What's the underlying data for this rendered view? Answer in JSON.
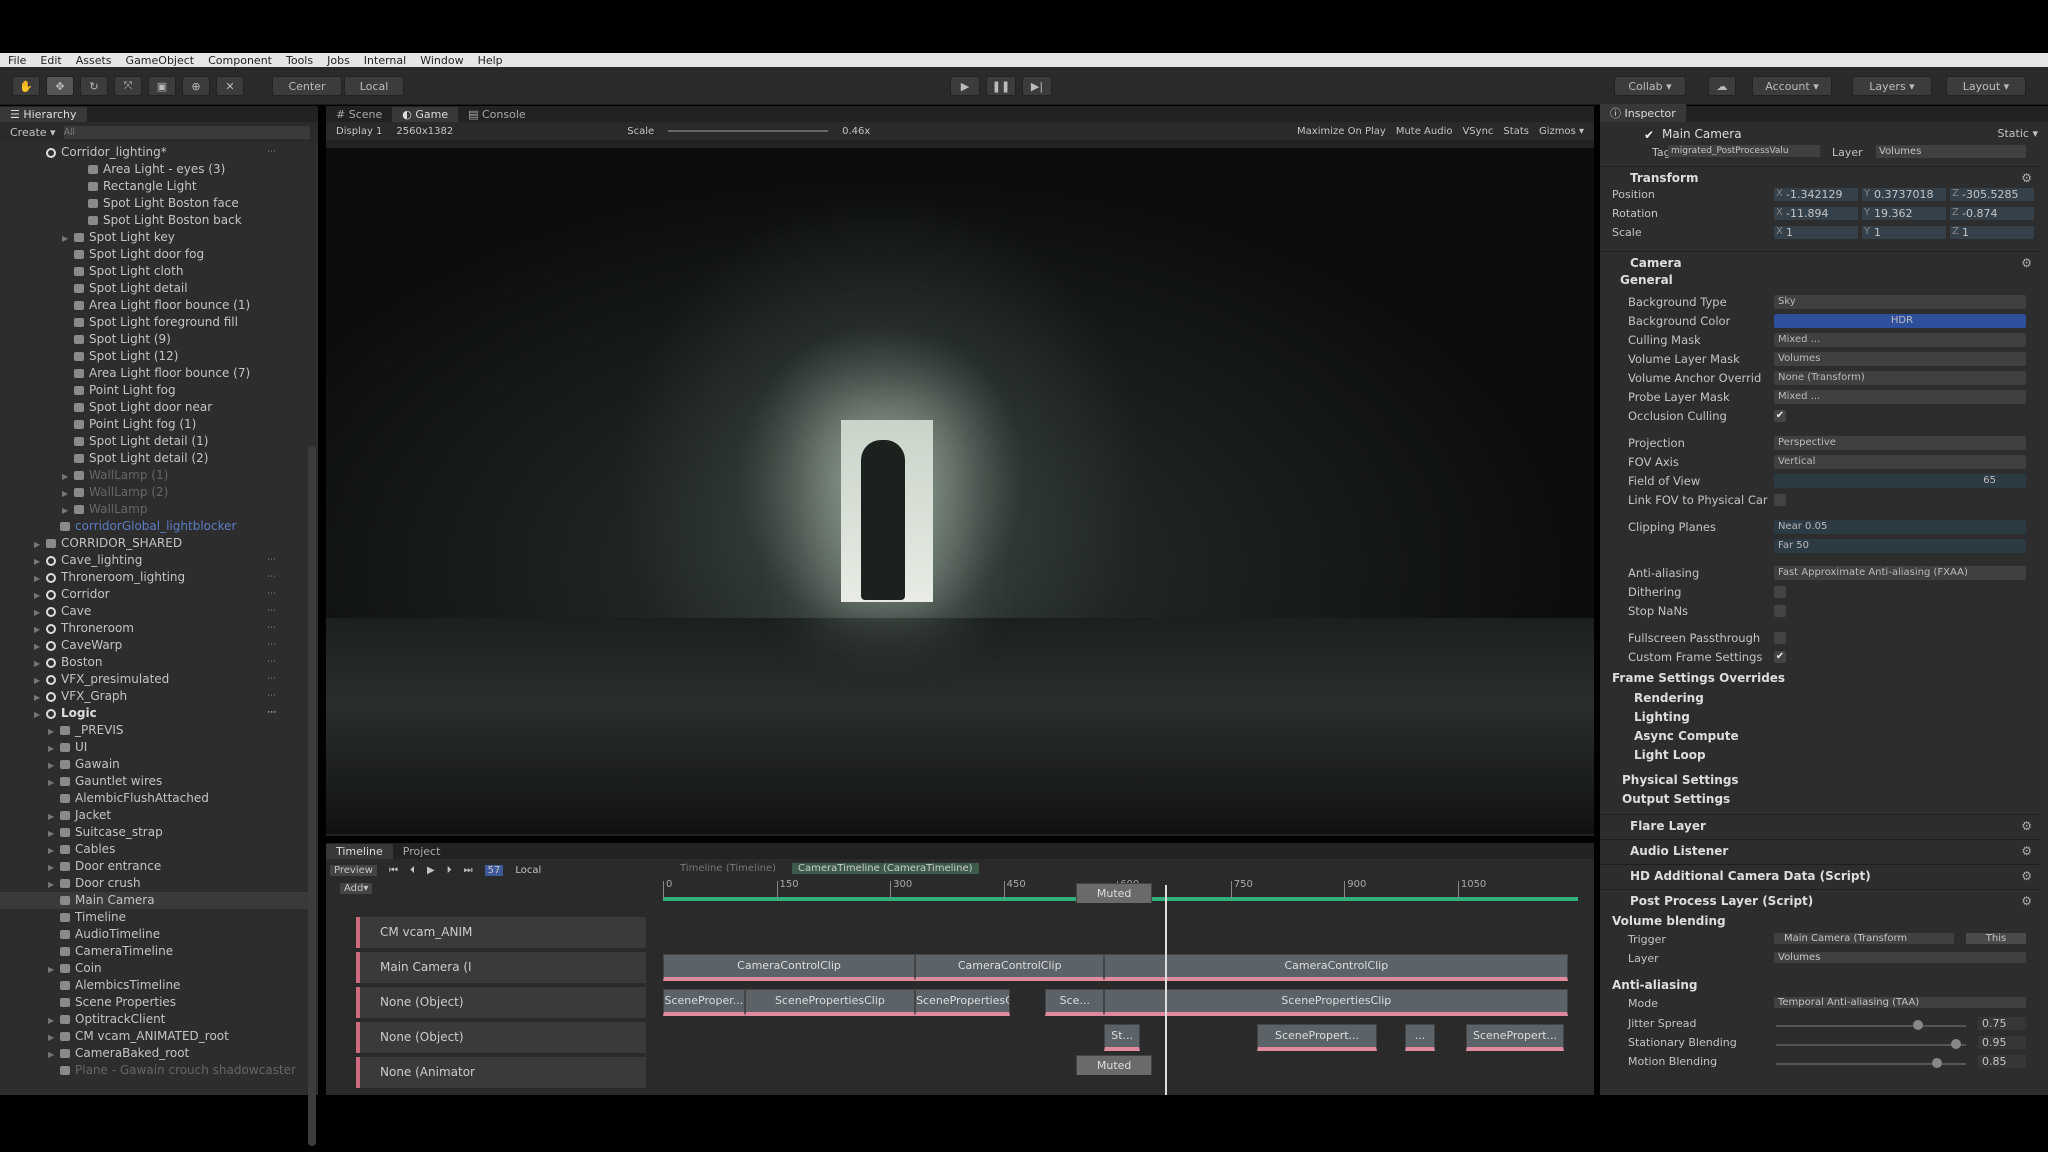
{
  "menu": [
    "File",
    "Edit",
    "Assets",
    "GameObject",
    "Component",
    "Tools",
    "Jobs",
    "Internal",
    "Window",
    "Help"
  ],
  "toolbar": {
    "center": "Center",
    "local": "Local",
    "collab": "Collab ▾",
    "account": "Account ▾",
    "layers": "Layers ▾",
    "layout": "Layout ▾"
  },
  "hierarchy": {
    "title": "Hierarchy",
    "create": "Create ▾",
    "search_placeholder": "All",
    "items": [
      {
        "label": "Corridor_lighting*",
        "depth": 1,
        "kind": "scene"
      },
      {
        "label": "Area Light - eyes (3)",
        "depth": 4,
        "kind": "obj"
      },
      {
        "label": "Rectangle Light",
        "depth": 4,
        "kind": "obj"
      },
      {
        "label": "Spot Light Boston face",
        "depth": 4,
        "kind": "obj"
      },
      {
        "label": "Spot Light Boston back",
        "depth": 4,
        "kind": "obj"
      },
      {
        "label": "Spot Light key",
        "depth": 3,
        "kind": "obj",
        "arrow": true
      },
      {
        "label": "Spot Light door fog",
        "depth": 3,
        "kind": "obj"
      },
      {
        "label": "Spot Light cloth",
        "depth": 3,
        "kind": "obj"
      },
      {
        "label": "Spot Light detail",
        "depth": 3,
        "kind": "obj"
      },
      {
        "label": "Area Light floor bounce (1)",
        "depth": 3,
        "kind": "obj"
      },
      {
        "label": "Spot Light foreground fill",
        "depth": 3,
        "kind": "obj"
      },
      {
        "label": "Spot Light (9)",
        "depth": 3,
        "kind": "obj"
      },
      {
        "label": "Spot Light (12)",
        "depth": 3,
        "kind": "obj"
      },
      {
        "label": "Area Light floor bounce (7)",
        "depth": 3,
        "kind": "obj"
      },
      {
        "label": "Point Light fog",
        "depth": 3,
        "kind": "obj"
      },
      {
        "label": "Spot Light door near",
        "depth": 3,
        "kind": "obj"
      },
      {
        "label": "Point Light fog (1)",
        "depth": 3,
        "kind": "obj"
      },
      {
        "label": "Spot Light detail (1)",
        "depth": 3,
        "kind": "obj"
      },
      {
        "label": "Spot Light detail (2)",
        "depth": 3,
        "kind": "obj"
      },
      {
        "label": "WallLamp (1)",
        "depth": 3,
        "kind": "obj",
        "arrow": true,
        "style": "dim"
      },
      {
        "label": "WallLamp (2)",
        "depth": 3,
        "kind": "obj",
        "arrow": true,
        "style": "dim"
      },
      {
        "label": "WallLamp",
        "depth": 3,
        "kind": "obj",
        "arrow": true,
        "style": "dim"
      },
      {
        "label": "corridorGlobal_lightblocker",
        "depth": 2,
        "kind": "obj",
        "style": "pref"
      },
      {
        "label": "CORRIDOR_SHARED",
        "depth": 1,
        "kind": "obj",
        "arrow": true
      },
      {
        "label": "Cave_lighting",
        "depth": 1,
        "kind": "scene",
        "arrow": true
      },
      {
        "label": "Throneroom_lighting",
        "depth": 1,
        "kind": "scene",
        "arrow": true
      },
      {
        "label": "Corridor",
        "depth": 1,
        "kind": "scene",
        "arrow": true
      },
      {
        "label": "Cave",
        "depth": 1,
        "kind": "scene",
        "arrow": true
      },
      {
        "label": "Throneroom",
        "depth": 1,
        "kind": "scene",
        "arrow": true
      },
      {
        "label": "CaveWarp",
        "depth": 1,
        "kind": "scene",
        "arrow": true
      },
      {
        "label": "Boston",
        "depth": 1,
        "kind": "scene",
        "arrow": true
      },
      {
        "label": "VFX_presimulated",
        "depth": 1,
        "kind": "scene",
        "arrow": true
      },
      {
        "label": "VFX_Graph",
        "depth": 1,
        "kind": "scene",
        "arrow": true
      },
      {
        "label": "Logic",
        "depth": 1,
        "kind": "scene",
        "arrow": true,
        "style": "bold"
      },
      {
        "label": "_PREVIS",
        "depth": 2,
        "kind": "obj",
        "arrow": true
      },
      {
        "label": "UI",
        "depth": 2,
        "kind": "obj",
        "arrow": true
      },
      {
        "label": "Gawain",
        "depth": 2,
        "kind": "obj",
        "arrow": true
      },
      {
        "label": "Gauntlet wires",
        "depth": 2,
        "kind": "obj",
        "arrow": true
      },
      {
        "label": "AlembicFlushAttached",
        "depth": 2,
        "kind": "obj"
      },
      {
        "label": "Jacket",
        "depth": 2,
        "kind": "obj",
        "arrow": true
      },
      {
        "label": "Suitcase_strap",
        "depth": 2,
        "kind": "obj",
        "arrow": true
      },
      {
        "label": "Cables",
        "depth": 2,
        "kind": "obj",
        "arrow": true
      },
      {
        "label": "Door entrance",
        "depth": 2,
        "kind": "obj",
        "arrow": true
      },
      {
        "label": "Door crush",
        "depth": 2,
        "kind": "obj",
        "arrow": true
      },
      {
        "label": "Main Camera",
        "depth": 2,
        "kind": "obj",
        "style": "sel"
      },
      {
        "label": "Timeline",
        "depth": 2,
        "kind": "obj"
      },
      {
        "label": "AudioTimeline",
        "depth": 2,
        "kind": "obj"
      },
      {
        "label": "CameraTimeline",
        "depth": 2,
        "kind": "obj"
      },
      {
        "label": "Coin",
        "depth": 2,
        "kind": "obj",
        "arrow": true
      },
      {
        "label": "AlembicsTimeline",
        "depth": 2,
        "kind": "obj"
      },
      {
        "label": "Scene Properties",
        "depth": 2,
        "kind": "obj"
      },
      {
        "label": "OptitrackClient",
        "depth": 2,
        "kind": "obj",
        "arrow": true
      },
      {
        "label": "CM vcam_ANIMATED_root",
        "depth": 2,
        "kind": "obj",
        "arrow": true
      },
      {
        "label": "CameraBaked_root",
        "depth": 2,
        "kind": "obj",
        "arrow": true
      },
      {
        "label": "Plane - Gawain crouch shadowcaster",
        "depth": 2,
        "kind": "obj",
        "style": "dim"
      }
    ]
  },
  "game": {
    "tabs": [
      "# Scene",
      "◐ Game",
      "▤ Console"
    ],
    "display": "Display 1",
    "resolution": "2560x1382",
    "scale_label": "Scale",
    "scale_value": "0.46x",
    "options": [
      "Maximize On Play",
      "Mute Audio",
      "VSync",
      "Stats",
      "Gizmos ▾"
    ]
  },
  "timeline": {
    "tabs": [
      "Timeline",
      "Project"
    ],
    "preview": "Preview",
    "add": "Add▾",
    "local": "Local",
    "frame": "57",
    "breadcrumb": [
      "Timeline (Timeline)",
      "CameraTimeline (CameraTimeline)"
    ],
    "ticks": [
      0,
      150,
      300,
      450,
      600,
      750,
      900,
      1050
    ],
    "max_frame": 1200,
    "playhead": 663,
    "tracks": [
      {
        "name": "CM vcam_ANIM",
        "clips": []
      },
      {
        "name": "Main Camera (I",
        "clips": [
          {
            "label": "CameraControlClip",
            "start": 0,
            "end": 333
          },
          {
            "label": "CameraControlClip",
            "start": 333,
            "end": 583
          },
          {
            "label": "CameraControlClip",
            "start": 583,
            "end": 1196
          }
        ]
      },
      {
        "name": "None (Object)",
        "clips": [
          {
            "label": "SceneProper...",
            "start": 0,
            "end": 108
          },
          {
            "label": "ScenePropertiesClip",
            "start": 108,
            "end": 333
          },
          {
            "label": "ScenePropertiesCl...",
            "start": 333,
            "end": 458
          },
          {
            "label": "Sce...",
            "start": 505,
            "end": 583
          },
          {
            "label": "ScenePropertiesClip",
            "start": 583,
            "end": 1196
          }
        ]
      },
      {
        "name": "None (Object)",
        "clips": [
          {
            "label": "St...",
            "start": 583,
            "end": 630
          },
          {
            "label": "ScenePropert...",
            "start": 785,
            "end": 943
          },
          {
            "label": "...",
            "start": 980,
            "end": 1020
          },
          {
            "label": "ScenePropert...",
            "start": 1061,
            "end": 1190
          }
        ]
      },
      {
        "name": "None (Animator",
        "clips": []
      }
    ],
    "muted_label": "Muted",
    "muted_start": 546,
    "muted_end": 646
  },
  "inspector": {
    "title": "Inspector",
    "object": "Main Camera",
    "static": "Static ▾",
    "tag_label": "Tag",
    "tag": "migrated_PostProcessValu",
    "layer_label": "Layer",
    "layer": "Volumes",
    "transform": {
      "title": "Transform",
      "rows": [
        {
          "label": "Position",
          "x": "-1.342129",
          "y": "0.3737018",
          "z": "-305.5285"
        },
        {
          "label": "Rotation",
          "x": "-11.894",
          "y": "19.362",
          "z": "-0.874"
        },
        {
          "label": "Scale",
          "x": "1",
          "y": "1",
          "z": "1"
        }
      ]
    },
    "camera": {
      "title": "Camera",
      "general": "General",
      "rows": [
        {
          "label": "Background Type",
          "type": "dd",
          "value": "Sky"
        },
        {
          "label": "Background Color",
          "type": "color",
          "value": "HDR"
        },
        {
          "label": "Culling Mask",
          "type": "dd",
          "value": "Mixed ..."
        },
        {
          "label": "Volume Layer Mask",
          "type": "dd",
          "value": "Volumes"
        },
        {
          "label": "Volume Anchor Overrid",
          "type": "dd",
          "value": "None (Transform)"
        },
        {
          "label": "Probe Layer Mask",
          "type": "dd",
          "value": "Mixed ..."
        },
        {
          "label": "Occlusion Culling",
          "type": "chk",
          "value": true
        },
        {
          "gap": true
        },
        {
          "label": "Projection",
          "type": "dd",
          "value": "Perspective"
        },
        {
          "label": "FOV Axis",
          "type": "dd",
          "value": "Vertical"
        },
        {
          "label": "Field of View",
          "type": "slider",
          "value": "65"
        },
        {
          "label": "Link FOV to Physical Car",
          "type": "chk",
          "value": false
        },
        {
          "gap": true
        },
        {
          "label": "Clipping Planes",
          "type": "text",
          "value": "Near   0.05"
        },
        {
          "label": "",
          "type": "text",
          "value": "Far    50"
        },
        {
          "gap": true
        },
        {
          "label": "Anti-aliasing",
          "type": "dd",
          "value": "Fast Approximate Anti-aliasing (FXAA)"
        },
        {
          "label": "Dithering",
          "type": "chk",
          "value": false
        },
        {
          "label": "Stop NaNs",
          "type": "chk",
          "value": false
        },
        {
          "gap": true
        },
        {
          "label": "Fullscreen Passthrough",
          "type": "chk",
          "value": false
        },
        {
          "label": "Custom Frame Settings",
          "type": "chk",
          "value": true
        }
      ],
      "overrides": "Frame Settings Overrides",
      "override_items": [
        "Rendering",
        "Lighting",
        "Async Compute",
        "Light Loop"
      ],
      "physical": "Physical Settings",
      "output": "Output Settings"
    },
    "components": [
      "Flare Layer",
      "Audio Listener",
      "HD Additional Camera Data (Script)",
      "Post Process Layer (Script)"
    ],
    "postprocess": {
      "volume_blending": "Volume blending",
      "trigger_label": "Trigger",
      "trigger": "Main Camera (Transform",
      "this_btn": "This",
      "layer_label": "Layer",
      "layer": "Volumes",
      "aa": "Anti-aliasing",
      "mode_label": "Mode",
      "mode": "Temporal Anti-aliasing (TAA)",
      "sliders": [
        {
          "label": "Jitter Spread",
          "value": 0.75
        },
        {
          "label": "Stationary Blending",
          "value": 0.95
        },
        {
          "label": "Motion Blending",
          "value": 0.85
        }
      ]
    }
  }
}
